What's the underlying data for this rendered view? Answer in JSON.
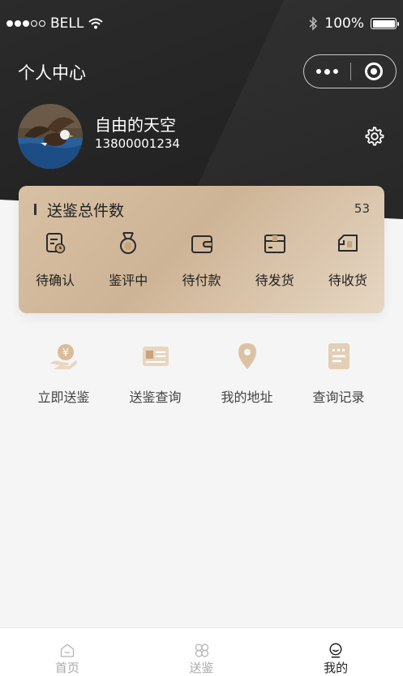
{
  "status_bar": {
    "carrier": "BELL",
    "battery": "100%",
    "signal_bars_filled": 3,
    "signal_bars_total": 5
  },
  "header": {
    "title": "个人中心"
  },
  "user": {
    "name": "自由的天空",
    "phone": "13800001234"
  },
  "summary_card": {
    "title": "送鉴总件数",
    "count": "53",
    "statuses": [
      {
        "label": "待确认",
        "icon": "clipboard-clock-icon"
      },
      {
        "label": "鉴评中",
        "icon": "medal-icon"
      },
      {
        "label": "待付款",
        "icon": "wallet-icon"
      },
      {
        "label": "待发货",
        "icon": "box-icon"
      },
      {
        "label": "待收货",
        "icon": "truck-icon"
      }
    ]
  },
  "functions": [
    {
      "label": "立即送鉴",
      "icon": "yuan-hand-icon"
    },
    {
      "label": "送鉴查询",
      "icon": "id-card-icon"
    },
    {
      "label": "我的地址",
      "icon": "location-pin-icon"
    },
    {
      "label": "查询记录",
      "icon": "record-list-icon"
    }
  ],
  "tabbar": [
    {
      "label": "首页",
      "icon": "home-icon",
      "active": false
    },
    {
      "label": "送鉴",
      "icon": "grid-icon",
      "active": false
    },
    {
      "label": "我的",
      "icon": "profile-icon",
      "active": true
    }
  ],
  "colors": {
    "header_bg": "#222222",
    "card_gold": "#d4bb9c",
    "icon_gold": "#c9a37c",
    "page_bg": "#f5f5f5"
  }
}
